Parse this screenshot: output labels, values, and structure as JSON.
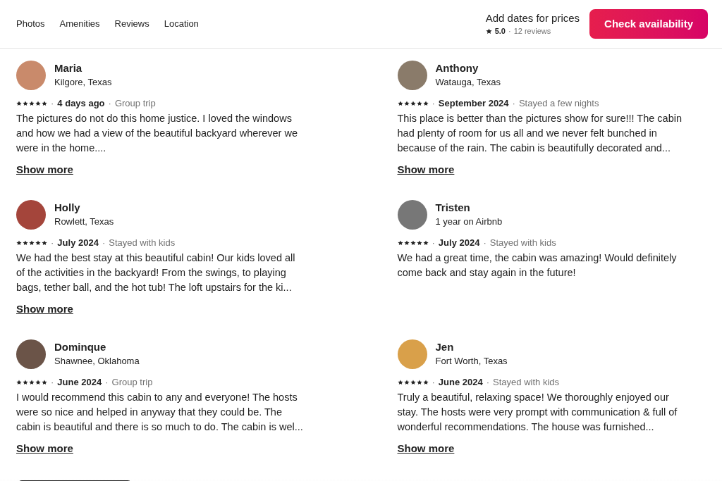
{
  "nav": {
    "links": [
      {
        "label": "Photos"
      },
      {
        "label": "Amenities"
      },
      {
        "label": "Reviews"
      },
      {
        "label": "Location"
      }
    ],
    "price_prompt": "Add dates for prices",
    "rating": "5.0",
    "separator": "·",
    "review_count": "12 reviews",
    "cta": "Check availability"
  },
  "reviews": [
    {
      "name": "Maria",
      "subtitle": "Kilgore, Texas",
      "stars": 5,
      "date": "4 days ago",
      "trip": "Group trip",
      "text": "The pictures do not do this home justice. I loved the windows and how we had a view of the beautiful backyard wherever we were in the home....",
      "show_more": "Show more"
    },
    {
      "name": "Anthony",
      "subtitle": "Watauga, Texas",
      "stars": 5,
      "date": "September 2024",
      "trip": "Stayed a few nights",
      "text": "This place is better than the pictures show for sure!!! The cabin had plenty of room for us all and we never felt bunched in because of the rain. The cabin is beautifully decorated and...",
      "show_more": "Show more"
    },
    {
      "name": "Holly",
      "subtitle": "Rowlett, Texas",
      "stars": 5,
      "date": "July 2024",
      "trip": "Stayed with kids",
      "text": "We had the best stay at this beautiful cabin! Our kids loved all of the activities in the backyard! From the swings, to playing bags, tether ball, and the hot tub! The loft upstairs for the ki...",
      "show_more": "Show more"
    },
    {
      "name": "Tristen",
      "subtitle": "1 year on Airbnb",
      "stars": 5,
      "date": "July 2024",
      "trip": "Stayed with kids",
      "text": "We had a great time, the cabin was amazing! Would definitely come back and stay again in the future!"
    },
    {
      "name": "Dominque",
      "subtitle": "Shawnee, Oklahoma",
      "stars": 5,
      "date": "June 2024",
      "trip": "Group trip",
      "text": "I would recommend this cabin to any and everyone! The hosts were so nice and helped in anyway that they could be. The cabin is beautiful and there is so much to do. The cabin is wel...",
      "show_more": "Show more"
    },
    {
      "name": "Jen",
      "subtitle": "Fort Worth, Texas",
      "stars": 5,
      "date": "June 2024",
      "trip": "Stayed with kids",
      "text": "Truly a beautiful, relaxing space! We thoroughly enjoyed our stay. The hosts were very prompt with communication & full of wonderful recommendations. The house was furnished...",
      "show_more": "Show more"
    }
  ]
}
